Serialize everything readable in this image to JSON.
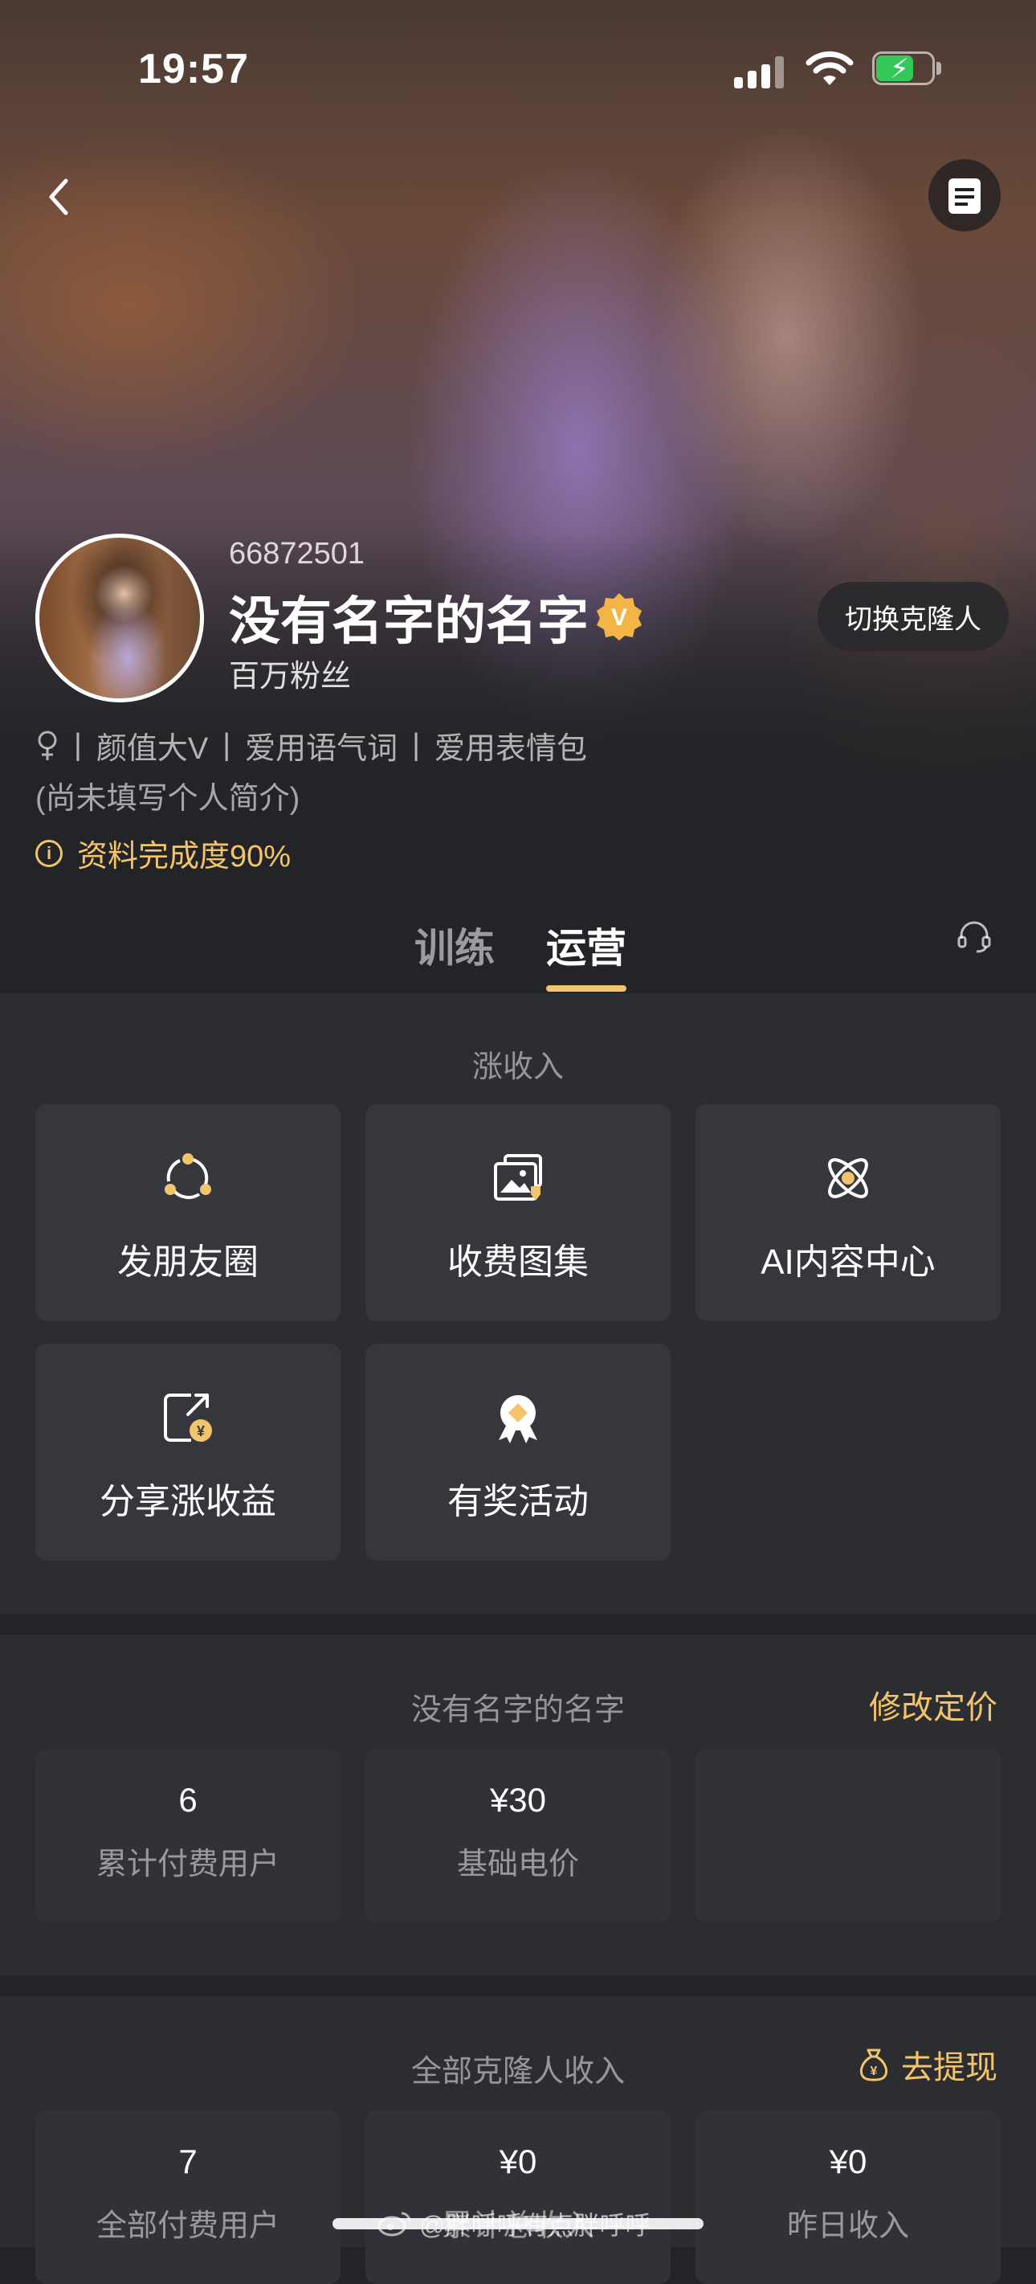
{
  "status_bar": {
    "time": "19:57"
  },
  "profile": {
    "id": "66872501",
    "name": "没有名字的名字",
    "verified_badge": "V",
    "fans": "百万粉丝",
    "switch_button": "切换克隆人",
    "tags": [
      "颜值大V",
      "爱用语气词",
      "爱用表情包"
    ],
    "tag_separator": "|",
    "bio": "(尚未填写个人简介)",
    "completion": "资料完成度90%"
  },
  "tabs": [
    {
      "label": "训练",
      "active": false
    },
    {
      "label": "运营",
      "active": true
    }
  ],
  "income_section": {
    "title": "涨收入",
    "items": [
      {
        "label": "发朋友圈",
        "icon": "moments-icon"
      },
      {
        "label": "收费图集",
        "icon": "paid-gallery-icon"
      },
      {
        "label": "AI内容中心",
        "icon": "ai-atom-icon"
      },
      {
        "label": "分享涨收益",
        "icon": "share-earn-icon"
      },
      {
        "label": "有奖活动",
        "icon": "reward-medal-icon"
      }
    ]
  },
  "pricing_section": {
    "title": "没有名字的名字",
    "action": "修改定价",
    "stats": [
      {
        "value": "6",
        "label": "累计付费用户"
      },
      {
        "value": "¥30",
        "label": "基础电价"
      }
    ]
  },
  "clone_income_section": {
    "title": "全部克隆人收入",
    "action": "去提现",
    "stats": [
      {
        "value": "7",
        "label": "全部付费用户"
      },
      {
        "value": "¥0",
        "label": "累计总收入"
      },
      {
        "value": "¥0",
        "label": "昨日收入"
      }
    ]
  },
  "watermark": "@胖呼呼有点胖呼呼",
  "colors": {
    "accent": "#f2c46b",
    "background": "#232427",
    "card": "#36373c"
  }
}
